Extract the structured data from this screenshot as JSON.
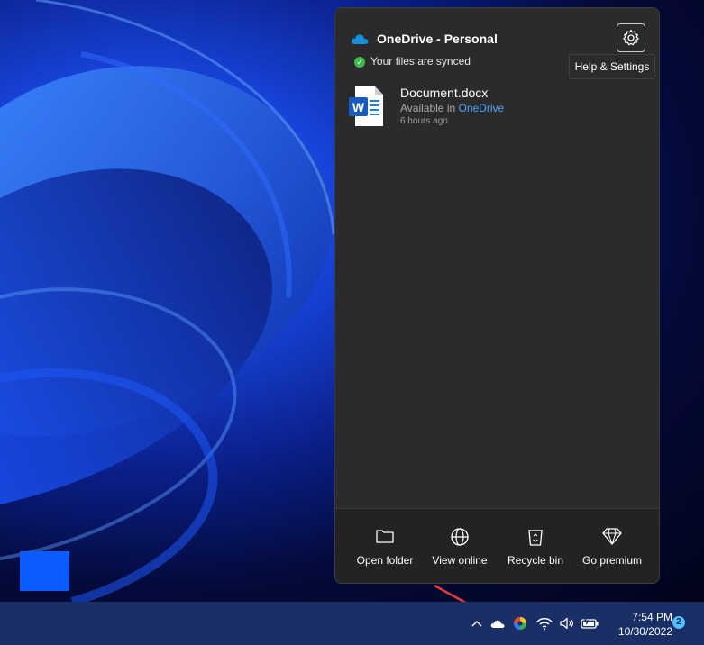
{
  "flyout": {
    "title": "OneDrive - Personal",
    "sync_status": "Your files are synced",
    "settings_tooltip": "Help & Settings",
    "file": {
      "name": "Document.docx",
      "available_prefix": "Available in ",
      "available_link": "OneDrive",
      "time": "6 hours ago",
      "icon_letter": "W"
    },
    "footer": [
      {
        "label": "Open folder",
        "icon": "folder-icon"
      },
      {
        "label": "View online",
        "icon": "globe-icon"
      },
      {
        "label": "Recycle bin",
        "icon": "recycle-bin-icon"
      },
      {
        "label": "Go premium",
        "icon": "diamond-icon"
      }
    ]
  },
  "taskbar": {
    "time": "7:54 PM",
    "date": "10/30/2022",
    "notification_count": "2"
  },
  "colors": {
    "flyout_bg": "#2b2b2b",
    "accent": "#4aa7ff",
    "onedrive_blue": "#1490df",
    "sync_green": "#3fb950",
    "taskbar_bg": "#1a2f66",
    "arrow_red": "#e23b3b"
  }
}
